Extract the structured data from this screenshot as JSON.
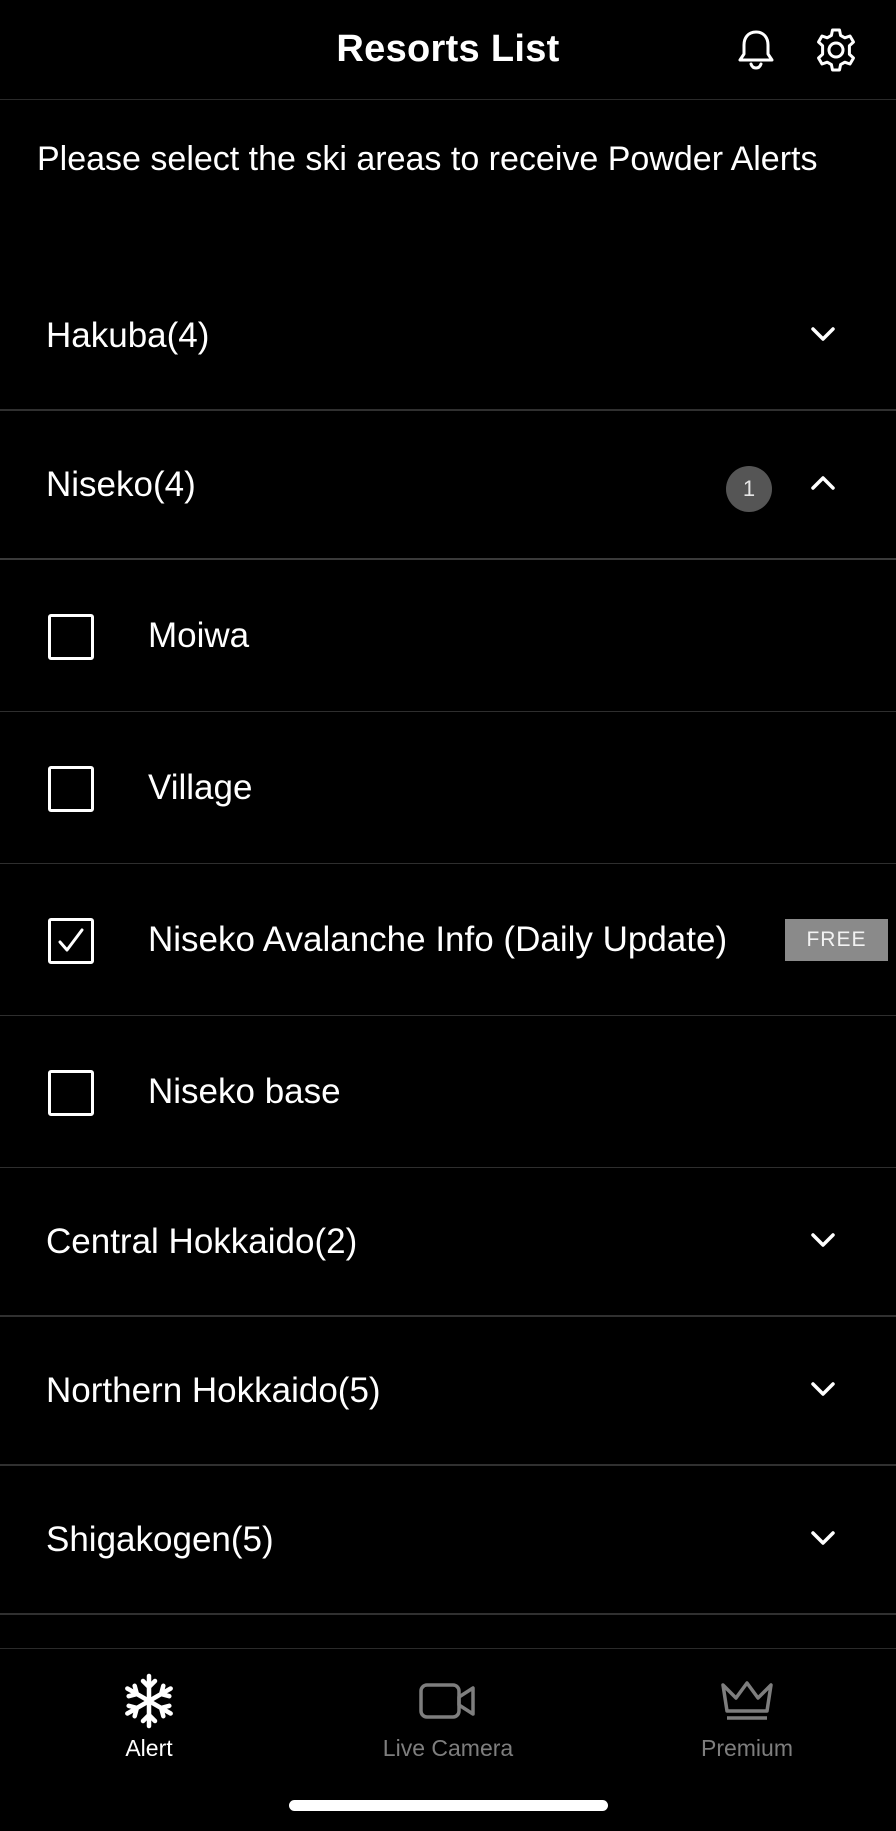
{
  "header": {
    "title": "Resorts List",
    "bell_icon": "bell-icon",
    "settings_icon": "gear-icon"
  },
  "intro": "Please select the ski areas to receive Powder Alerts",
  "groups": [
    {
      "label": "Hakuba(4)",
      "expanded": false
    },
    {
      "label": "Niseko(4)",
      "expanded": true,
      "selected_count": "1",
      "items": [
        {
          "label": "Moiwa",
          "checked": false
        },
        {
          "label": "Village",
          "checked": false
        },
        {
          "label": "Niseko Avalanche Info (Daily Update)",
          "checked": true,
          "tag": "FREE"
        },
        {
          "label": "Niseko base",
          "checked": false
        }
      ]
    },
    {
      "label": "Central Hokkaido(2)",
      "expanded": false
    },
    {
      "label": "Northern Hokkaido(5)",
      "expanded": false
    },
    {
      "label": "Shigakogen(5)",
      "expanded": false
    }
  ],
  "tabs": [
    {
      "label": "Alert",
      "icon": "snowflake-icon",
      "active": true
    },
    {
      "label": "Live Camera",
      "icon": "video-camera-icon",
      "active": false
    },
    {
      "label": "Premium",
      "icon": "crown-icon",
      "active": false
    }
  ],
  "colors": {
    "background": "#000000",
    "text": "#ffffff",
    "inactive_tab": "#7e7e7e",
    "badge": "#555555",
    "free_tag": "#8a8a8a"
  }
}
